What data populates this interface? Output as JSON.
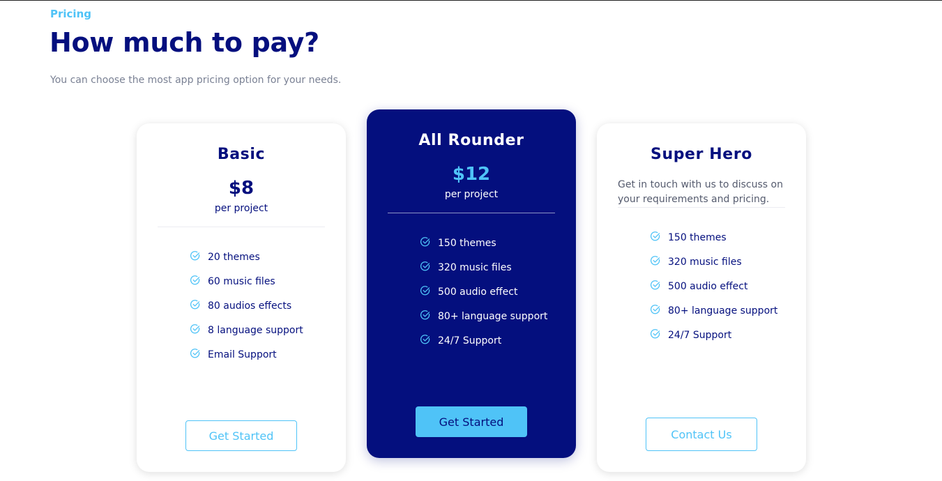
{
  "header": {
    "eyebrow": "Pricing",
    "title": "How much to pay?",
    "subtitle": "You can choose the most app pricing option for your needs."
  },
  "plans": [
    {
      "name": "Basic",
      "price": "$8",
      "per": "per project",
      "features": [
        "20 themes",
        "60 music files",
        "80 audios effects",
        "8 language support",
        "Email Support"
      ],
      "button": "Get Started"
    },
    {
      "name": "All Rounder",
      "price": "$12",
      "per": "per project",
      "features": [
        "150 themes",
        "320 music files",
        "500 audio effect",
        "80+ language support",
        "24/7 Support"
      ],
      "button": "Get Started"
    },
    {
      "name": "Super Hero",
      "description": "Get in touch with us to discuss on your requirements and pricing.",
      "features": [
        "150 themes",
        "320 music files",
        "500 audio effect",
        "80+ language support",
        "24/7 Support"
      ],
      "button": "Contact Us"
    }
  ],
  "icons": {
    "feature": "check-circle-icon"
  },
  "colors": {
    "primary": "#040f7e",
    "accent": "#4fc3f7",
    "muted": "#7a8194"
  }
}
